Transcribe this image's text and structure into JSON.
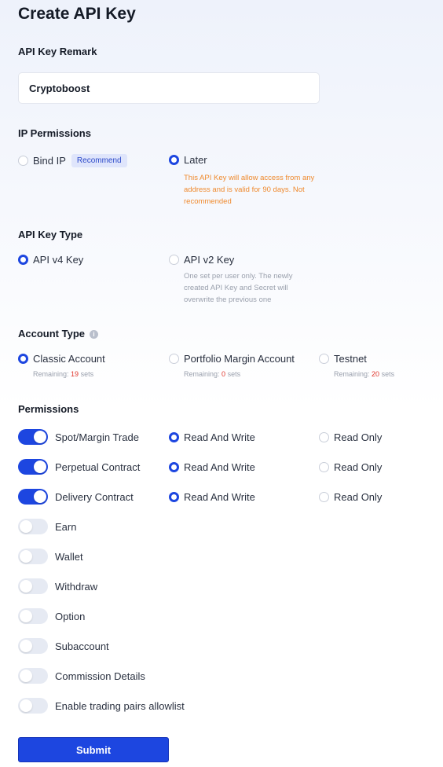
{
  "page_title": "Create API Key",
  "remark": {
    "label": "API Key Remark",
    "value": "Cryptoboost"
  },
  "ip_permissions": {
    "label": "IP Permissions",
    "bind_ip": "Bind IP",
    "recommend_badge": "Recommend",
    "later": "Later",
    "later_note": "This API Key will allow access from any address and is valid for 90 days. Not recommended",
    "selected": "later"
  },
  "key_type": {
    "label": "API Key Type",
    "v4": "API v4 Key",
    "v2": "API v2 Key",
    "v2_note": "One set per user only. The newly created API Key and Secret will overwrite the previous one",
    "selected": "v4"
  },
  "account_type": {
    "label": "Account Type",
    "remaining_prefix": "Remaining:",
    "remaining_suffix": "sets",
    "options": [
      {
        "label": "Classic Account",
        "remaining": "19",
        "selected": true
      },
      {
        "label": "Portfolio Margin Account",
        "remaining": "0",
        "selected": false
      },
      {
        "label": "Testnet",
        "remaining": "20",
        "selected": false
      }
    ]
  },
  "permissions": {
    "label": "Permissions",
    "read_write": "Read And Write",
    "read_only": "Read Only",
    "items": [
      {
        "label": "Spot/Margin Trade",
        "enabled": true,
        "mode": "read_write"
      },
      {
        "label": "Perpetual Contract",
        "enabled": true,
        "mode": "read_write"
      },
      {
        "label": "Delivery Contract",
        "enabled": true,
        "mode": "read_write"
      },
      {
        "label": "Earn",
        "enabled": false
      },
      {
        "label": "Wallet",
        "enabled": false
      },
      {
        "label": "Withdraw",
        "enabled": false
      },
      {
        "label": "Option",
        "enabled": false
      },
      {
        "label": "Subaccount",
        "enabled": false
      },
      {
        "label": "Commission Details",
        "enabled": false
      },
      {
        "label": "Enable trading pairs allowlist",
        "enabled": false
      }
    ]
  },
  "submit_label": "Submit",
  "colors": {
    "accent": "#1d46e0",
    "warning": "#ef8a2e",
    "remaining_number": "#e0362c"
  }
}
